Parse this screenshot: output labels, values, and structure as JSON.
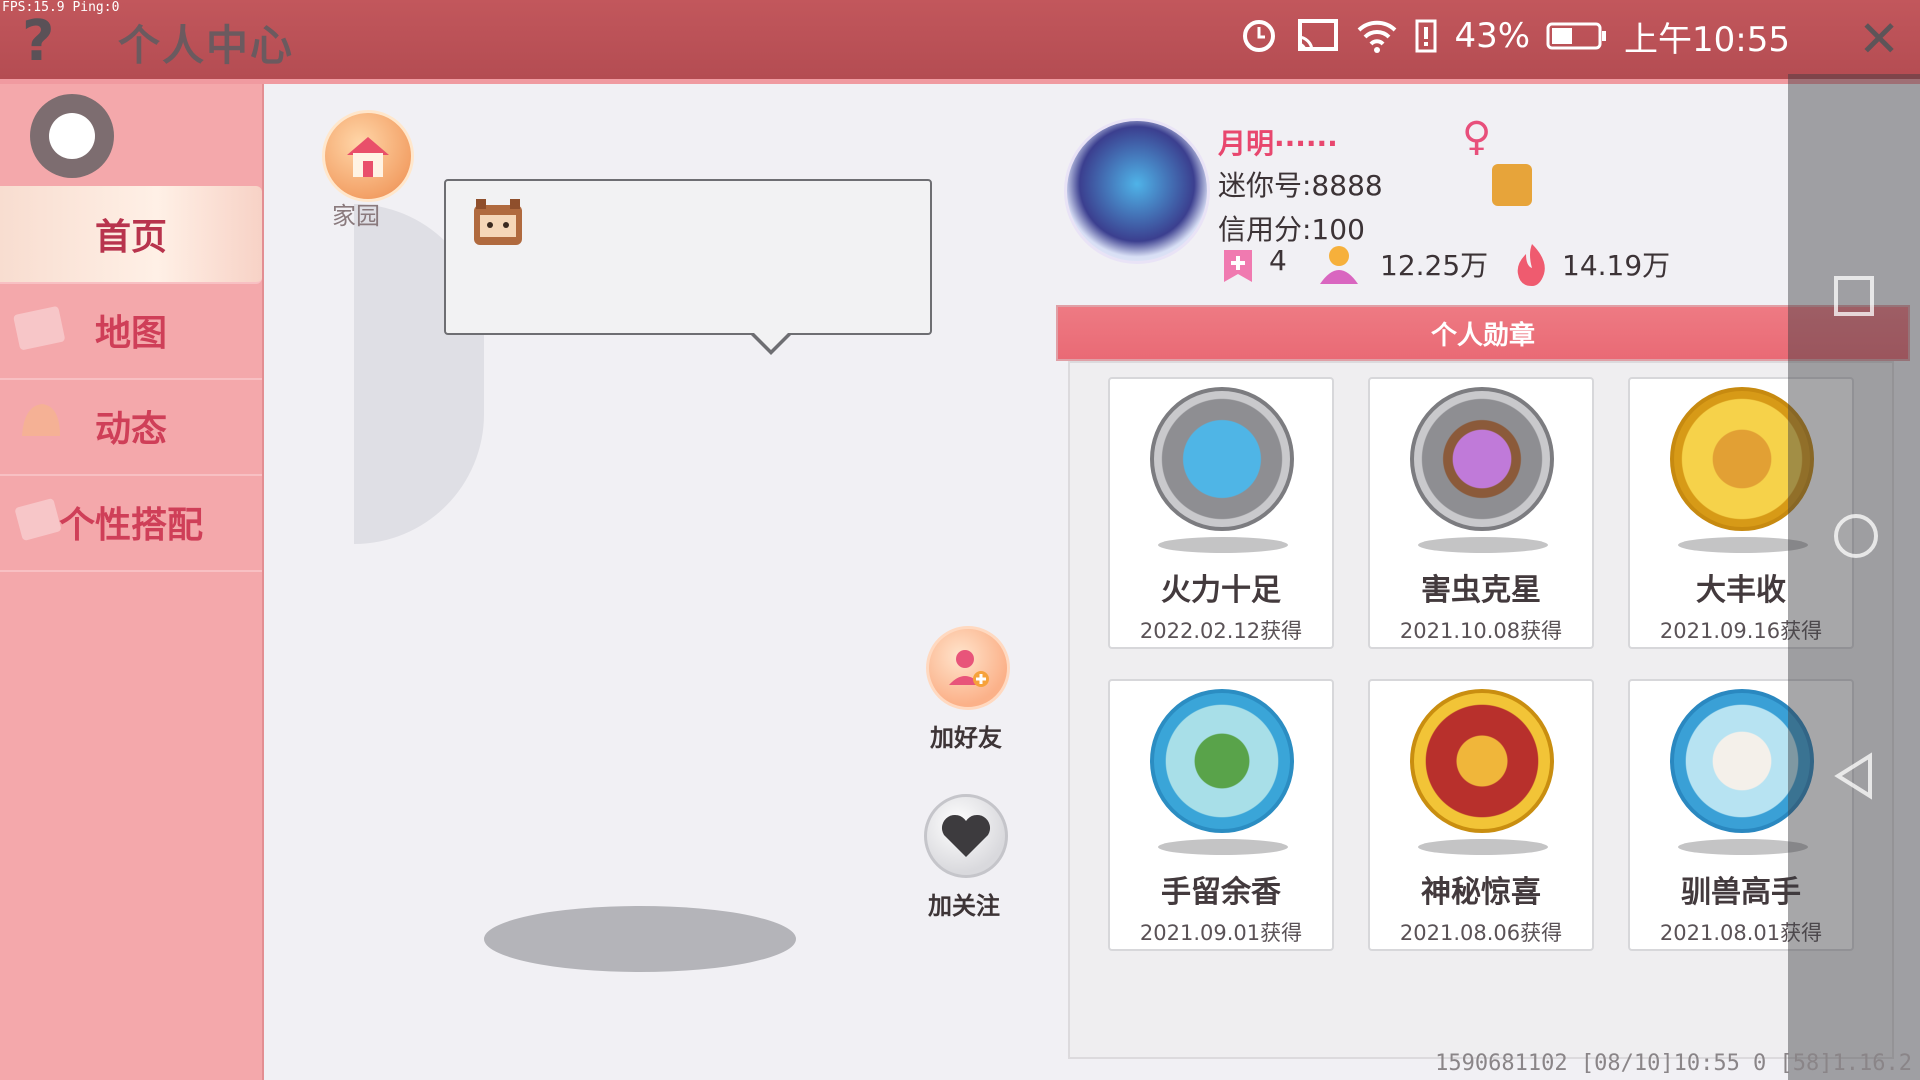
{
  "status": {
    "fps": "FPS:15.9 Ping:0",
    "battery": "43%",
    "time": "上午10:55"
  },
  "header": {
    "title": "个人中心"
  },
  "sidebar": {
    "items": [
      {
        "label": "首页",
        "active": true
      },
      {
        "label": "地图",
        "active": false
      },
      {
        "label": "动态",
        "active": false
      },
      {
        "label": "个性搭配",
        "active": false
      }
    ]
  },
  "main": {
    "home_label": "家园",
    "add_friend_label": "加好友",
    "follow_label": "加关注"
  },
  "profile": {
    "name": "月明······",
    "mini_id": "迷你号:8888",
    "credit": "信用分:100",
    "stat_1": "4",
    "stat_2": "12.25万",
    "stat_3": "14.19万"
  },
  "medals": {
    "title": "个人勋章",
    "items": [
      {
        "name": "火力十足",
        "date": "2022.02.12获得"
      },
      {
        "name": "害虫克星",
        "date": "2021.10.08获得"
      },
      {
        "name": "大丰收",
        "date": "2021.09.16获得"
      },
      {
        "name": "手留余香",
        "date": "2021.09.01获得"
      },
      {
        "name": "神秘惊喜",
        "date": "2021.08.06获得"
      },
      {
        "name": "驯兽高手",
        "date": "2021.08.01获得"
      }
    ]
  },
  "footer": {
    "info": "1590681102  [08/10]10:55 0  [58]1.16.2"
  }
}
